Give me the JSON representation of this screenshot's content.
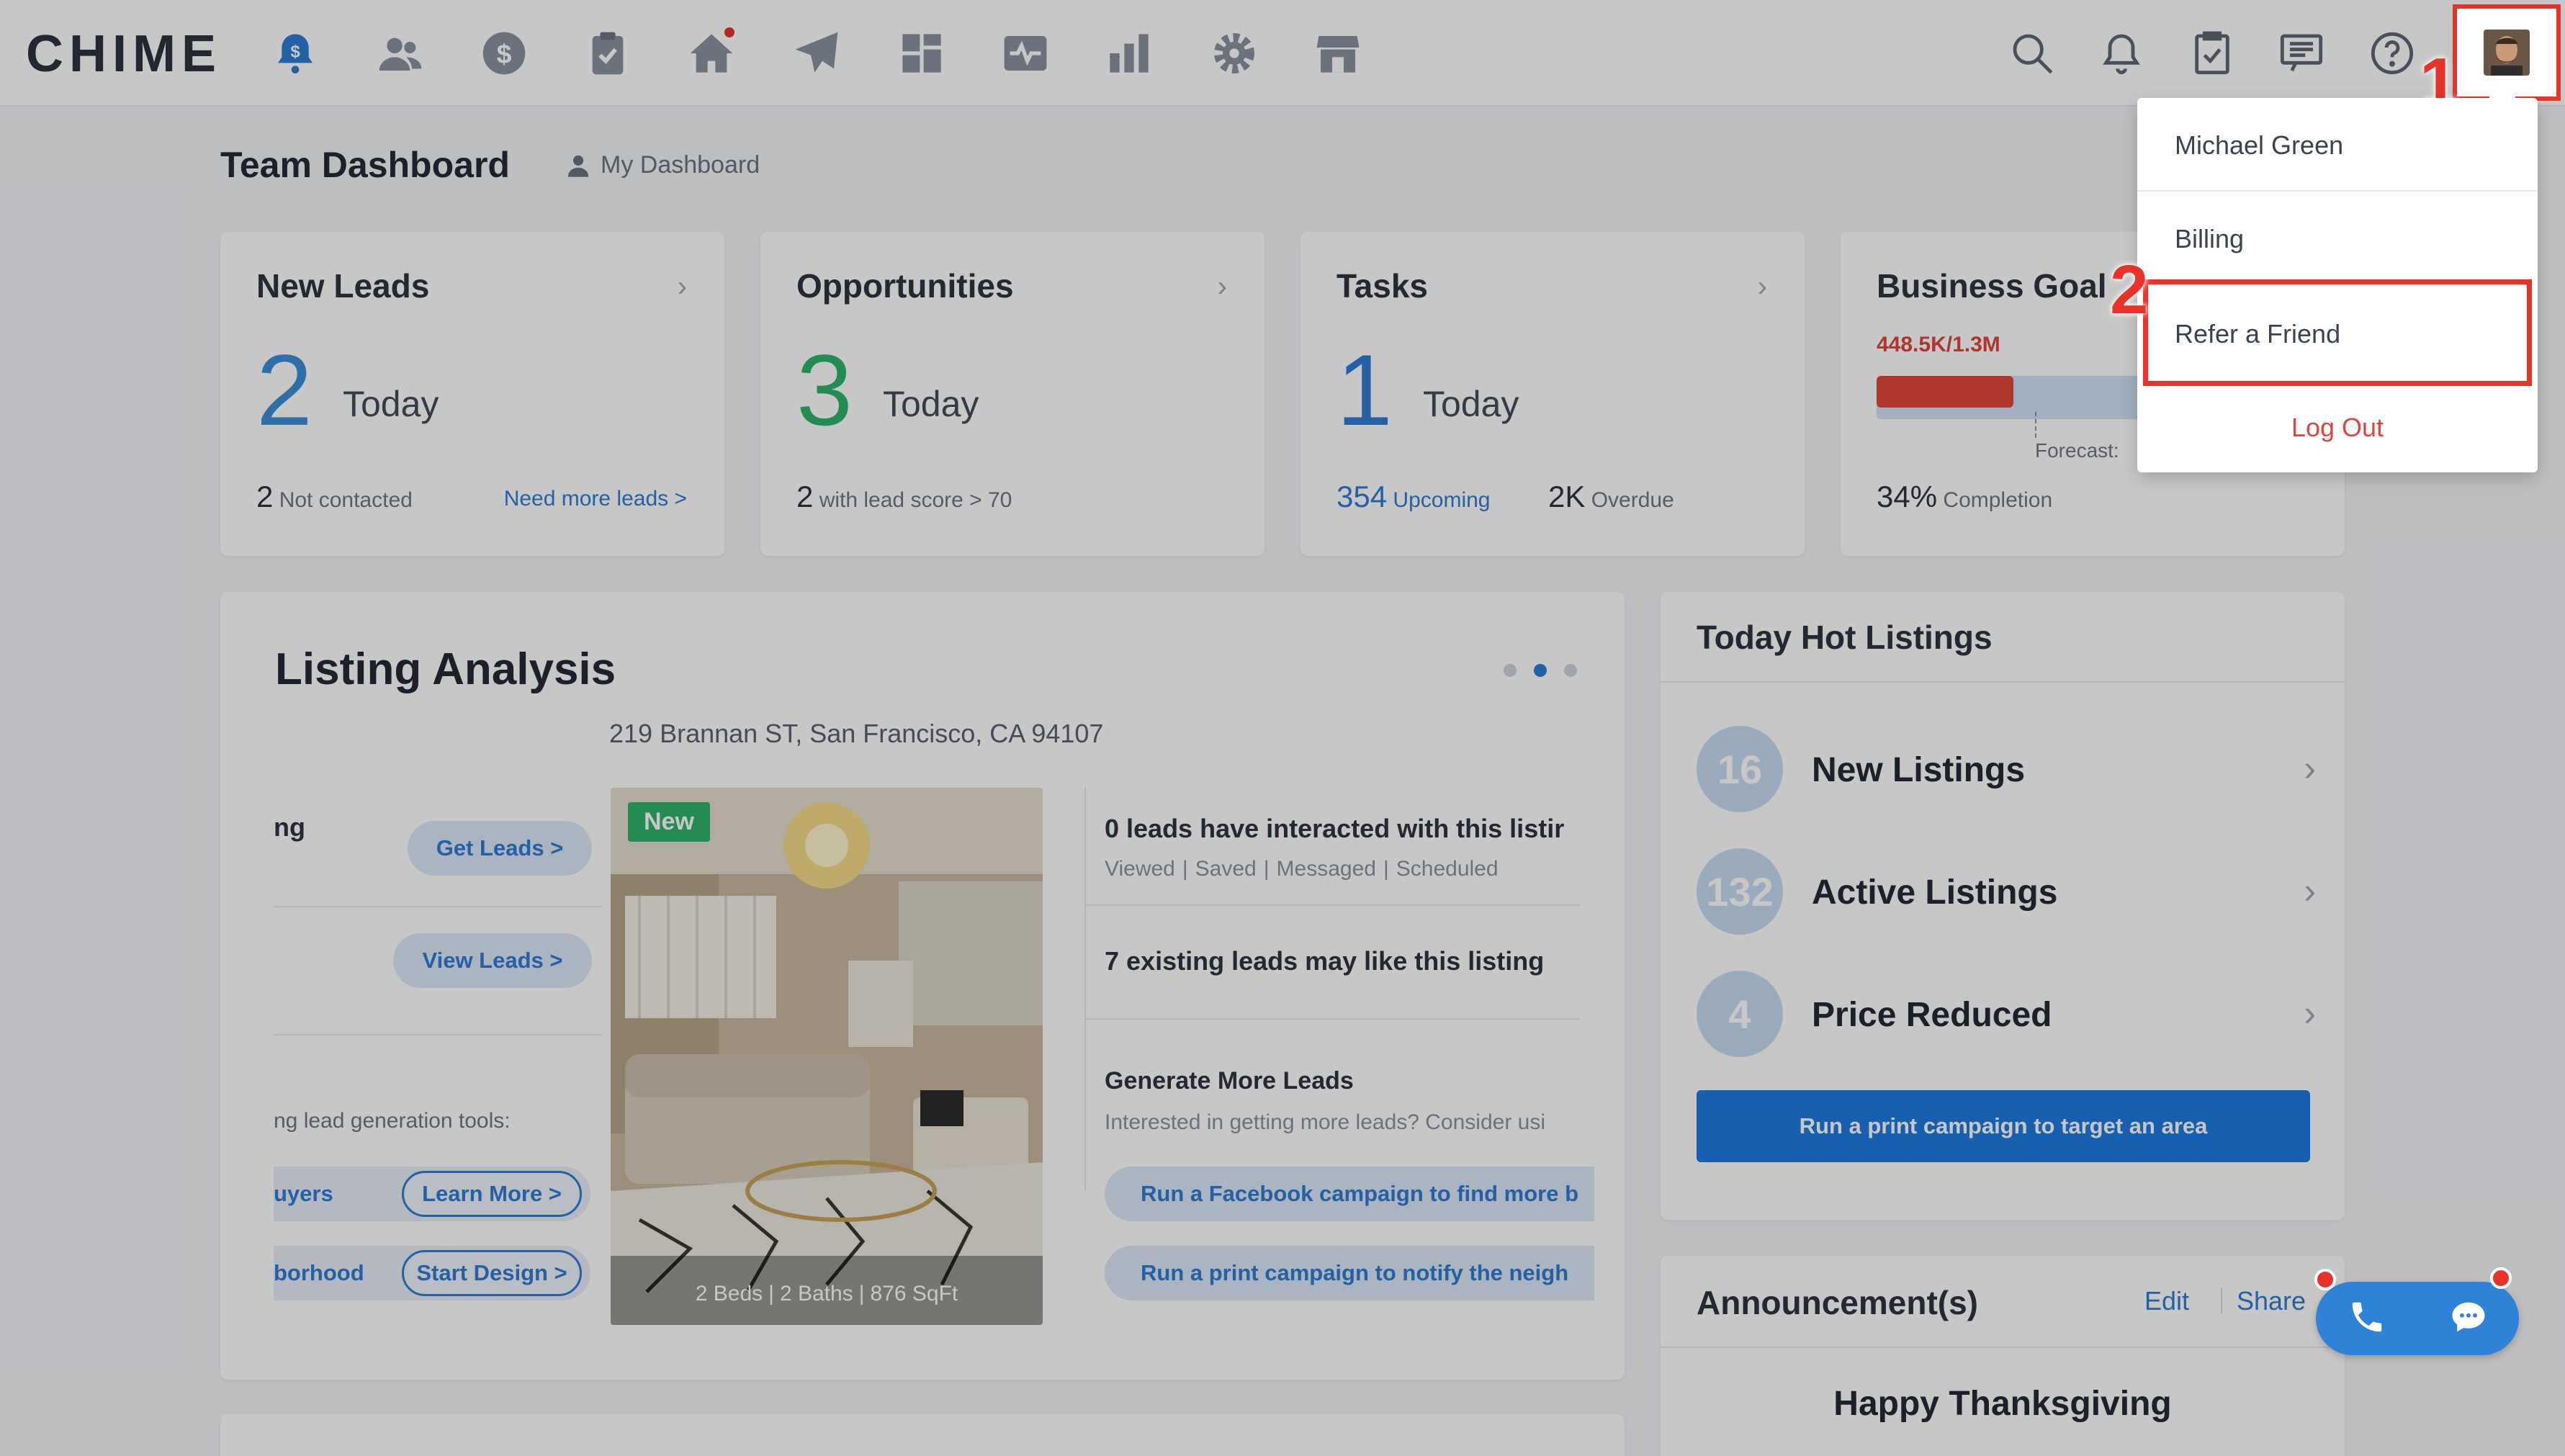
{
  "app": {
    "logo": "CHIME",
    "accent": "#2d7bd2",
    "alert_color": "#e8332b"
  },
  "nav": {
    "icons": [
      "dollar-bell-icon",
      "people-icon",
      "dollar-icon",
      "clipboard-check-icon",
      "home-icon",
      "paper-plane-icon",
      "grid-icon",
      "pulse-icon",
      "bar-chart-icon",
      "gear-icon",
      "storefront-icon"
    ],
    "right_icons": [
      "search-icon",
      "bell-icon",
      "clipboard-icon",
      "message-icon",
      "help-icon"
    ]
  },
  "header": {
    "title": "Team Dashboard",
    "my_dashboard": "My Dashboard"
  },
  "stats": {
    "new_leads": {
      "title": "New Leads",
      "count": "2",
      "today": "Today",
      "foot_num": "2",
      "foot_text": "Not contacted",
      "link": "Need more leads >"
    },
    "opportunities": {
      "title": "Opportunities",
      "count": "3",
      "today": "Today",
      "foot_num": "2",
      "foot_text": "with lead score > 70"
    },
    "tasks": {
      "title": "Tasks",
      "count": "1",
      "today": "Today",
      "upcoming_num": "354",
      "upcoming_text": "Upcoming",
      "overdue_num": "2K",
      "overdue_text": "Overdue"
    },
    "goal": {
      "title": "Business Goal",
      "amount": "448.5K/1.3M",
      "forecast": "Forecast:",
      "completion_num": "34%",
      "completion_text": "Completion",
      "progress": 0.34
    }
  },
  "listing_analysis": {
    "title": "Listing Analysis",
    "address": "219 Brannan ST, San Francisco, CA 94107",
    "page_dots": 3,
    "active_dot": 1,
    "left_col": {
      "row1_fragment": "ng",
      "get_leads": "Get Leads >",
      "view_leads": "View Leads >",
      "tools_text": "ng lead generation tools:",
      "buyers_fragment": "uyers",
      "learn_more": "Learn More >",
      "neighborhood_fragment": "borhood",
      "start_design": "Start Design >"
    },
    "photo": {
      "badge": "New",
      "beds": "2 Beds",
      "baths": "2 Baths",
      "sqft": "876 SqFt"
    },
    "right_col": {
      "interacted": "0 leads have interacted with this listir",
      "interacted_meta": [
        "Viewed",
        "Saved",
        "Messaged",
        "Scheduled"
      ],
      "existing": "7 existing leads may like this listing",
      "generate_title": "Generate More Leads",
      "generate_text": "Interested in getting more leads? Consider usi",
      "facebook_btn": "Run a Facebook campaign to find more b",
      "print_btn": "Run a print campaign to notify the neigh"
    }
  },
  "hot_listings": {
    "title": "Today Hot Listings",
    "rows": [
      {
        "count": "16",
        "label": "New Listings"
      },
      {
        "count": "132",
        "label": "Active Listings"
      },
      {
        "count": "4",
        "label": "Price Reduced"
      }
    ],
    "cta": "Run a print campaign to target an area"
  },
  "announcements": {
    "title": "Announcement(s)",
    "edit": "Edit",
    "share": "Share",
    "body": "Happy Thanksgiving"
  },
  "user_menu": {
    "items": [
      "Michael Green",
      "Billing",
      "Refer a Friend",
      "Log Out"
    ],
    "step1": "1",
    "step2": "2"
  }
}
